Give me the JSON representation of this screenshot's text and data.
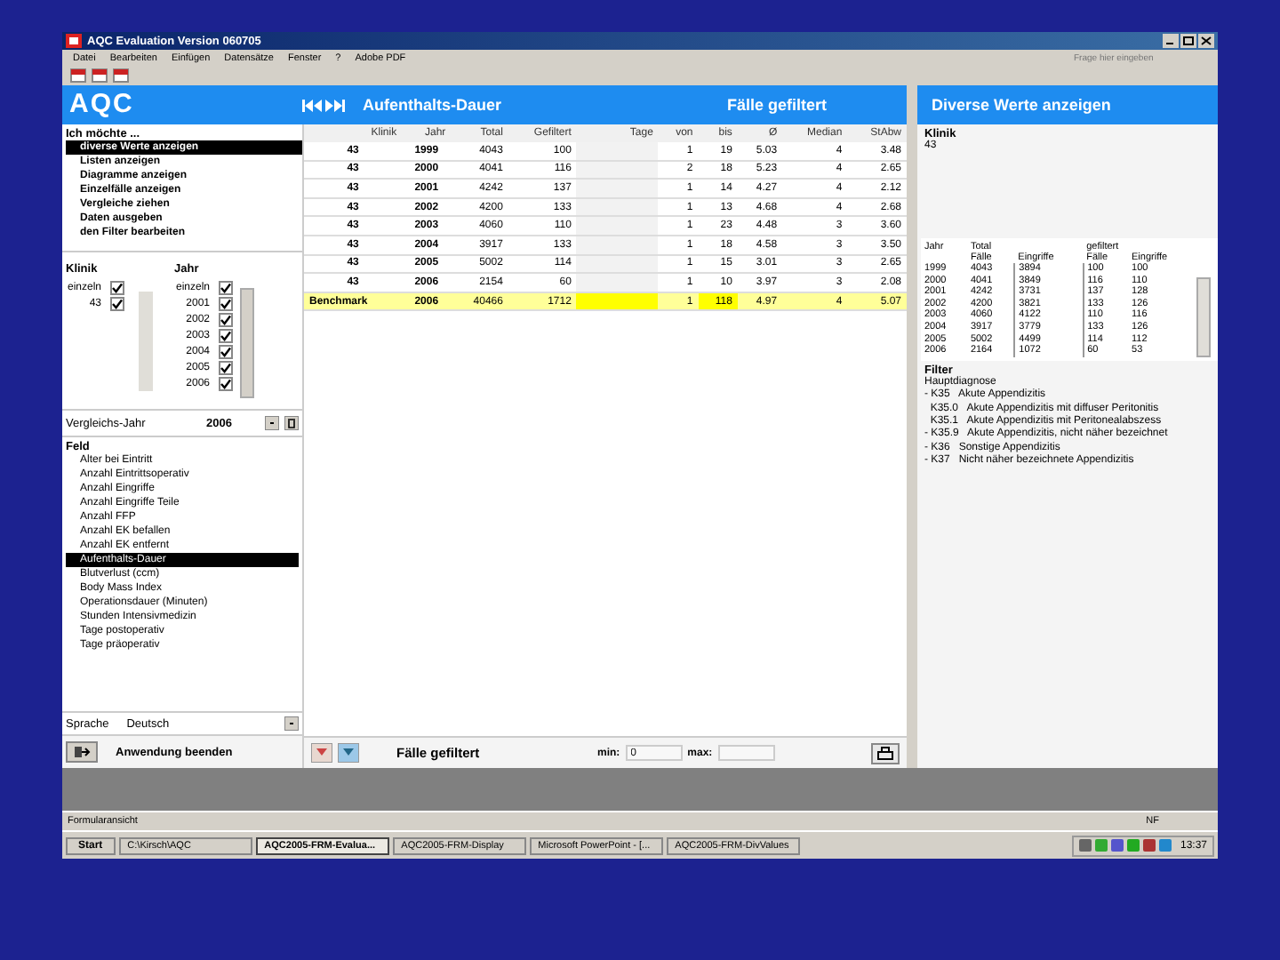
{
  "window": {
    "title": "AQC Evaluation Version 060705"
  },
  "menu": [
    "Datei",
    "Bearbeiten",
    "Einfügen",
    "Datensätze",
    "Fenster",
    "?",
    "Adobe PDF"
  ],
  "help_box": {
    "placeholder": "Frage hier eingeben"
  },
  "logo": "AQC",
  "header": {
    "title": "Aufenthalts-Dauer",
    "filter_label": "Fälle gefiltert",
    "right_title": "Diverse Werte anzeigen"
  },
  "actions": {
    "heading": "Ich möchte ...",
    "items": [
      {
        "label": "diverse Werte anzeigen",
        "selected": true
      },
      {
        "label": "Listen anzeigen",
        "selected": false
      },
      {
        "label": "Diagramme anzeigen",
        "selected": false
      },
      {
        "label": "Einzelfälle anzeigen",
        "selected": false
      },
      {
        "label": "Vergleiche ziehen",
        "selected": false
      },
      {
        "label": "Daten ausgeben",
        "selected": false
      },
      {
        "label": "den Filter bearbeiten",
        "selected": false
      }
    ]
  },
  "klinik": {
    "heading": "Klinik",
    "items": [
      {
        "label": "einzeln",
        "checked": true
      },
      {
        "label": "43",
        "checked": true
      }
    ]
  },
  "jahr": {
    "heading": "Jahr",
    "items": [
      {
        "label": "einzeln",
        "checked": true
      },
      {
        "label": "2001",
        "checked": true
      },
      {
        "label": "2002",
        "checked": true
      },
      {
        "label": "2003",
        "checked": true
      },
      {
        "label": "2004",
        "checked": true
      },
      {
        "label": "2005",
        "checked": true
      },
      {
        "label": "2006",
        "checked": true
      }
    ]
  },
  "vergleichsjahr": {
    "label": "Vergleichs-Jahr",
    "value": "2006"
  },
  "feld": {
    "heading": "Feld",
    "items": [
      {
        "label": "Alter bei Eintritt",
        "selected": false
      },
      {
        "label": "Anzahl Eintrittsoperativ",
        "selected": false
      },
      {
        "label": "Anzahl Eingriffe",
        "selected": false
      },
      {
        "label": "Anzahl Eingriffe Teile",
        "selected": false
      },
      {
        "label": "Anzahl FFP",
        "selected": false
      },
      {
        "label": "Anzahl EK befallen",
        "selected": false
      },
      {
        "label": "Anzahl EK entfernt",
        "selected": false
      },
      {
        "label": "Aufenthalts-Dauer",
        "selected": true
      },
      {
        "label": "Blutverlust (ccm)",
        "selected": false
      },
      {
        "label": "Body Mass Index",
        "selected": false
      },
      {
        "label": "Operationsdauer (Minuten)",
        "selected": false
      },
      {
        "label": "Stunden Intensivmedizin",
        "selected": false
      },
      {
        "label": "Tage postoperativ",
        "selected": false
      },
      {
        "label": "Tage präoperativ",
        "selected": false
      }
    ]
  },
  "sprache": {
    "label": "Sprache",
    "value": "Deutsch"
  },
  "exit_button": "Anwendung beenden",
  "table": {
    "columns": [
      "Klinik",
      "Jahr",
      "Total",
      "Gefiltert",
      "Tage",
      "von",
      "bis",
      "Ø",
      "Median",
      "StAbw"
    ],
    "rows": [
      {
        "kind": "year",
        "cells": [
          "43",
          "1999",
          "4043",
          "100",
          "",
          "1",
          "19",
          "5.03",
          "4",
          "3.48"
        ]
      },
      {
        "kind": "year",
        "cells": [
          "43",
          "2000",
          "4041",
          "116",
          "",
          "2",
          "18",
          "5.23",
          "4",
          "2.65"
        ]
      },
      {
        "kind": "year",
        "cells": [
          "43",
          "2001",
          "4242",
          "137",
          "",
          "1",
          "14",
          "4.27",
          "4",
          "2.12"
        ]
      },
      {
        "kind": "year",
        "cells": [
          "43",
          "2002",
          "4200",
          "133",
          "",
          "1",
          "13",
          "4.68",
          "4",
          "2.68"
        ]
      },
      {
        "kind": "year",
        "cells": [
          "43",
          "2003",
          "4060",
          "110",
          "",
          "1",
          "23",
          "4.48",
          "3",
          "3.60"
        ]
      },
      {
        "kind": "year",
        "cells": [
          "43",
          "2004",
          "3917",
          "133",
          "",
          "1",
          "18",
          "4.58",
          "3",
          "3.50"
        ]
      },
      {
        "kind": "year",
        "cells": [
          "43",
          "2005",
          "5002",
          "114",
          "",
          "1",
          "15",
          "3.01",
          "3",
          "2.65"
        ]
      },
      {
        "kind": "year",
        "cells": [
          "43",
          "2006",
          "2154",
          "60",
          "",
          "1",
          "10",
          "3.97",
          "3",
          "2.08"
        ]
      },
      {
        "kind": "benchmark",
        "cells": [
          "Benchmark",
          "2006",
          "40466",
          "1712",
          "",
          "1",
          "118",
          "4.97",
          "4",
          "5.07"
        ]
      }
    ]
  },
  "bottom_bar": {
    "label": "Fälle gefiltert",
    "min_label": "min:",
    "min_value": "0",
    "max_label": "max:"
  },
  "right": {
    "klinik_heading": "Klinik",
    "klinik_value": "43",
    "table": {
      "headers": [
        "Jahr",
        "Total",
        "gefiltert"
      ],
      "subheaders": [
        "Fälle",
        "Eingriffe",
        "Fälle",
        "Eingriffe"
      ],
      "rows": [
        [
          "1999",
          "4043",
          "3894",
          "100",
          "100"
        ],
        [
          "2000",
          "4041",
          "3849",
          "116",
          "110"
        ],
        [
          "2001",
          "4242",
          "3731",
          "137",
          "128"
        ],
        [
          "2002",
          "4200",
          "3821",
          "133",
          "126"
        ],
        [
          "2003",
          "4060",
          "4122",
          "110",
          "116"
        ],
        [
          "2004",
          "3917",
          "3779",
          "133",
          "126"
        ],
        [
          "2005",
          "5002",
          "4499",
          "114",
          "112"
        ],
        [
          "2006",
          "2164",
          "1072",
          "60",
          "53"
        ]
      ]
    },
    "filter_heading": "Filter",
    "filter_lines": [
      "Hauptdiagnose",
      "- K35   Akute Appendizitis",
      "  K35.0   Akute Appendizitis mit diffuser Peritonitis",
      "  K35.1   Akute Appendizitis mit Peritonealabszess",
      "- K35.9   Akute Appendizitis, nicht näher bezeichnet",
      "- K36   Sonstige Appendizitis",
      "- K37   Nicht näher bezeichnete Appendizitis"
    ]
  },
  "status_bar": {
    "left": "Formularansicht",
    "right": "NF"
  },
  "taskbar": {
    "start": "Start",
    "tasks": [
      {
        "label": "C:\\Kirsch\\AQC",
        "selected": false
      },
      {
        "label": "AQC2005-FRM-Evalua...",
        "selected": true
      },
      {
        "label": "AQC2005-FRM-Display",
        "selected": false
      },
      {
        "label": "Microsoft PowerPoint - [...",
        "selected": false
      },
      {
        "label": "AQC2005-FRM-DivValues",
        "selected": false
      }
    ],
    "clock": "13:37"
  }
}
